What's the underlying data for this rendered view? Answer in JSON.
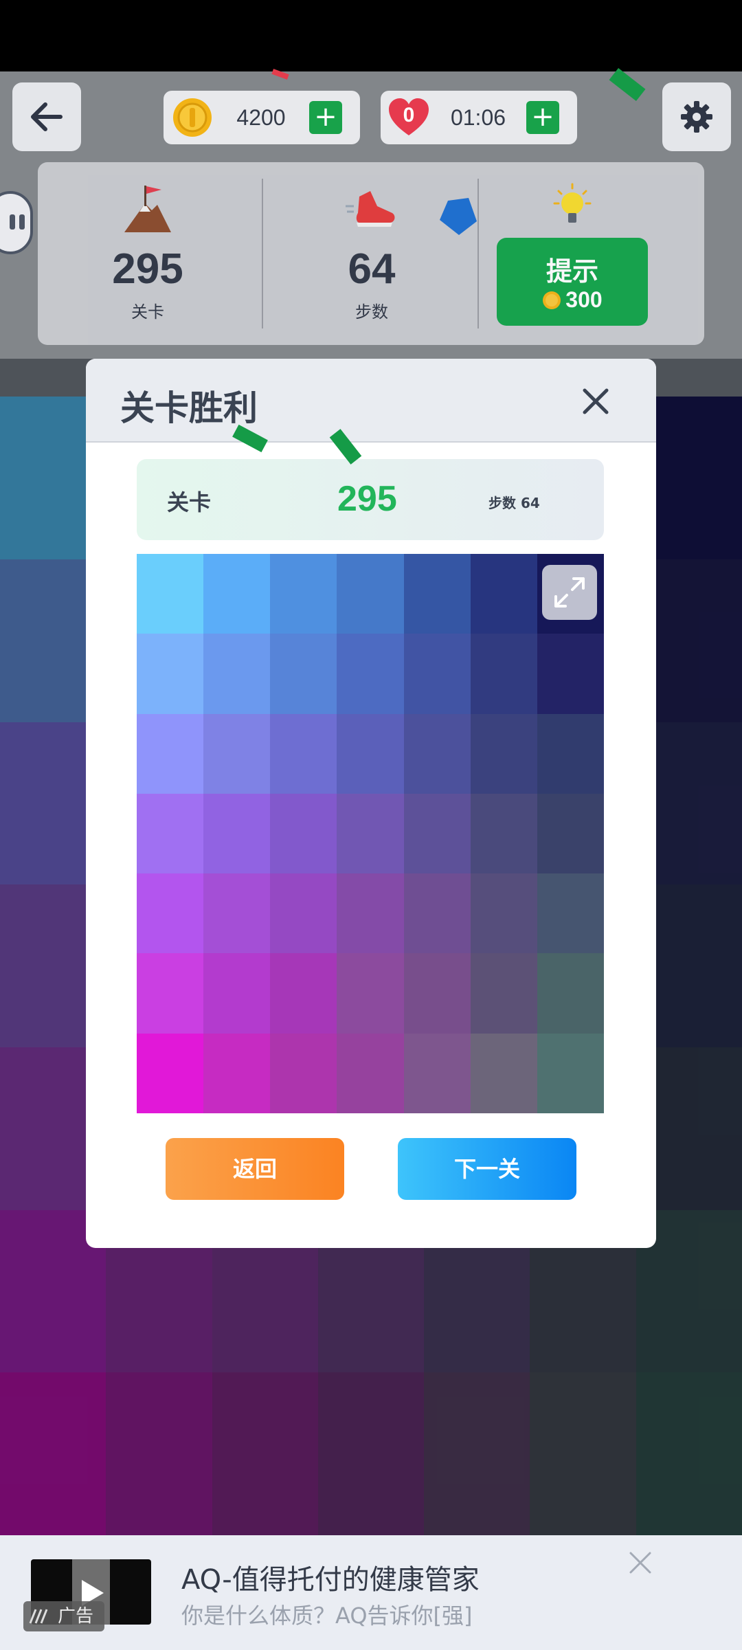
{
  "top_bar": {
    "coins": "4200",
    "timer": "01:06",
    "lives": "0"
  },
  "stats": {
    "level_value": "295",
    "level_label": "关卡",
    "steps_value": "64",
    "steps_label": "步数",
    "hint_label": "提示",
    "hint_cost": "300"
  },
  "dialog": {
    "title": "关卡胜利",
    "info_label": "关卡",
    "info_level": "295",
    "info_steps": "步数 64",
    "back_label": "返回",
    "next_label": "下一关"
  },
  "result_grid_colors": [
    [
      "#6acefc",
      "#5badf8",
      "#4f90e0",
      "#4579c9",
      "#3556a4",
      "#27357f",
      "#161858"
    ],
    [
      "#7cb2fb",
      "#6b99ee",
      "#5784d8",
      "#4d6bc2",
      "#4154a4",
      "#313b80",
      "#232366"
    ],
    [
      "#8f94fb",
      "#7f82e5",
      "#6e6ed2",
      "#5b60ba",
      "#4c519c",
      "#3b427e",
      "#313c6e"
    ],
    [
      "#a070f2",
      "#9163e2",
      "#8259cc",
      "#7157b3",
      "#5d5199",
      "#4a4a7c",
      "#3a426a"
    ],
    [
      "#b355ee",
      "#a44fd6",
      "#9549c3",
      "#844ba8",
      "#6f4e93",
      "#564e7c",
      "#465570"
    ],
    [
      "#ca3fe2",
      "#b33bce",
      "#a637b8",
      "#8c4b9e",
      "#784e8c",
      "#5c5176",
      "#4a6468"
    ],
    [
      "#e118d8",
      "#c62bc2",
      "#ad35ad",
      "#96429e",
      "#7e568e",
      "#6c657a",
      "#4f7170"
    ]
  ],
  "bg_grid_colors": [
    [
      "#6c737c",
      "#6c737c",
      "#6c737c",
      "#6c737c",
      "#6c737c",
      "#6c737c",
      "#6c737c"
    ],
    [
      "#6c737c",
      "#6c737c",
      "#6c737c",
      "#6c737c",
      "#6c737c",
      "#6c737c",
      "#6c737c"
    ],
    [
      "#47a5d6",
      "#4b8ed8",
      "#3f79c2",
      "#3b65b0",
      "#334e94",
      "#27306e",
      "#14144a"
    ],
    [
      "#567ec2",
      "#5073c0",
      "#4665b3",
      "#3f55a1",
      "#344589",
      "#293469",
      "#1c1c4c"
    ],
    [
      "#675ebd",
      "#5e58b0",
      "#554ea0",
      "#4a4691",
      "#3e3f7d",
      "#323867",
      "#222650"
    ],
    [
      "#714ca7",
      "#684aa3",
      "#5f4693",
      "#544280",
      "#463d72",
      "#393a5f",
      "#252c4a"
    ],
    [
      "#7e389e",
      "#742f96",
      "#6a3388",
      "#5d3978",
      "#4d3c68",
      "#3e3d5a",
      "#2b3446"
    ],
    [
      "#8f21a0",
      "#7b2b8d",
      "#6c3382",
      "#5b3a72",
      "#493d63",
      "#3c4250",
      "#2f4648"
    ],
    [
      "#a00f95",
      "#851d87",
      "#722477",
      "#5f2d6a",
      "#4f3b5c",
      "#404650",
      "#2d4c48"
    ]
  ],
  "ad": {
    "badge": "广告",
    "title": "AQ-值得托付的健康管家",
    "subtitle": "你是什么体质？AQ告诉你[强]"
  }
}
